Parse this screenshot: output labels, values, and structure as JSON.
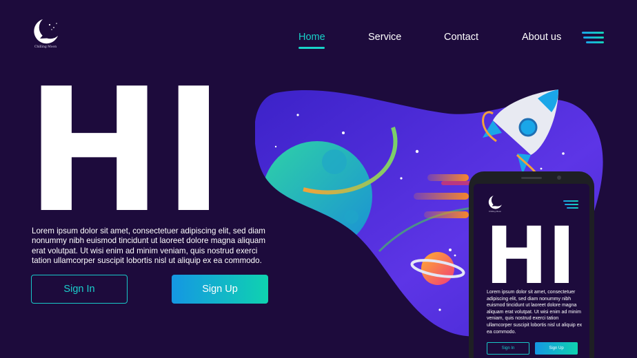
{
  "brand": {
    "name": "Chilling Moon",
    "logo_icon": "crescent-moon-icon"
  },
  "nav": {
    "items": [
      {
        "label": "Home",
        "active": true
      },
      {
        "label": "Service",
        "active": false
      },
      {
        "label": "Contact",
        "active": false
      },
      {
        "label": "About us",
        "active": false
      }
    ],
    "menu_icon": "hamburger-menu-icon"
  },
  "hero": {
    "heading": "HI",
    "body": "Lorem ipsum dolor sit amet, consectetuer adipiscing elit, sed diam nonummy nibh euismod tincidunt ut laoreet dolore magna aliquam erat volutpat. Ut wisi enim ad minim veniam, quis nostrud exerci tation ullamcorper suscipit lobortis nisl ut aliquip ex ea commodo."
  },
  "buttons": {
    "sign_in": "Sign In",
    "sign_up": "Sign Up"
  },
  "phone_preview": {
    "brand": "Chilling Moon",
    "heading": "HI",
    "body": "Lorem ipsum dolor sit amet, consectetuer adipiscing elit, sed diam nonummy nibh euismod tincidunt ut laoreet dolore magna aliquam erat volutpat. Ut wisi enim ad minim veniam, quis nostrud exerci tation ullamcorper suscipit lobortis nisl ut aliquip ex ea commodo.",
    "sign_in": "Sign In",
    "sign_up": "Sign Up"
  },
  "colors": {
    "background": "#1d0b3c",
    "accent": "#18d3c9",
    "gradient_start": "#1597e3",
    "gradient_end": "#0fd2b0",
    "blob": "#5b30e0"
  }
}
